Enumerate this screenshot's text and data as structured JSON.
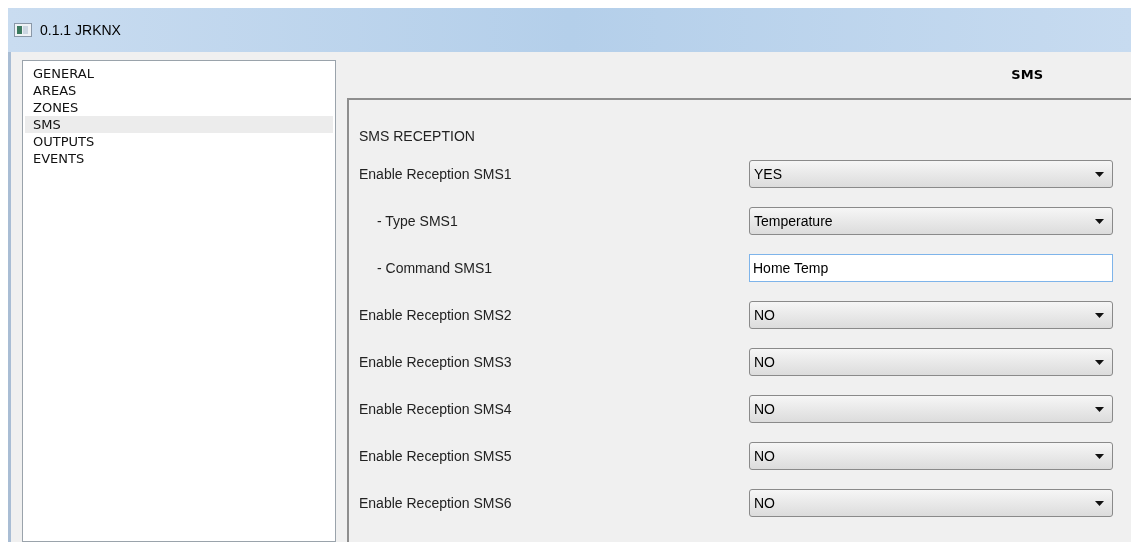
{
  "window": {
    "title": "0.1.1 JRKNX"
  },
  "sidebar": {
    "items": [
      {
        "label": "GENERAL",
        "selected": false
      },
      {
        "label": "AREAS",
        "selected": false
      },
      {
        "label": "ZONES",
        "selected": false
      },
      {
        "label": "SMS",
        "selected": true
      },
      {
        "label": "OUTPUTS",
        "selected": false
      },
      {
        "label": "EVENTS",
        "selected": false
      }
    ]
  },
  "panel": {
    "title": "SMS",
    "section": "SMS RECEPTION",
    "rows": [
      {
        "label": "Enable Reception SMS1",
        "kind": "dropdown",
        "value": "YES",
        "children": [
          {
            "label": "- Type SMS1",
            "kind": "dropdown",
            "value": "Temperature"
          },
          {
            "label": "- Command SMS1",
            "kind": "text",
            "value": "Home Temp"
          }
        ]
      },
      {
        "label": "Enable Reception SMS2",
        "kind": "dropdown",
        "value": "NO"
      },
      {
        "label": "Enable Reception SMS3",
        "kind": "dropdown",
        "value": "NO"
      },
      {
        "label": "Enable Reception SMS4",
        "kind": "dropdown",
        "value": "NO"
      },
      {
        "label": "Enable Reception SMS5",
        "kind": "dropdown",
        "value": "NO"
      },
      {
        "label": "Enable Reception SMS6",
        "kind": "dropdown",
        "value": "NO"
      }
    ]
  }
}
